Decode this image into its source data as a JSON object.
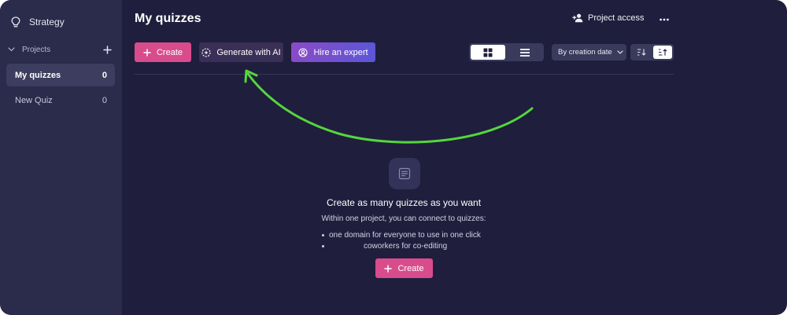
{
  "sidebar": {
    "strategy_label": "Strategy",
    "projects_label": "Projects",
    "items": [
      {
        "label": "My quizzes",
        "count": "0"
      },
      {
        "label": "New Quiz",
        "count": "0"
      }
    ]
  },
  "header": {
    "title": "My quizzes",
    "project_access_label": "Project access"
  },
  "toolbar": {
    "create_label": "Create",
    "generate_ai_label": "Generate with AI",
    "hire_expert_label": "Hire an expert",
    "sort_by_label": "By creation date"
  },
  "empty_state": {
    "title": "Create as many quizzes as you want",
    "subtitle": "Within one project, you can connect to quizzes:",
    "bullets": [
      "one domain for everyone to use in one click",
      "coworkers for co-editing"
    ],
    "create_label": "Create"
  },
  "colors": {
    "background": "#1f1e3d",
    "sidebar": "#2b2b4c",
    "accent_pink": "#d84c8c",
    "ai_button": "#3a2f56",
    "hire_gradient_start": "#8a4bc6",
    "hire_gradient_end": "#5c56d8",
    "annotation_arrow": "#54d63d"
  },
  "icons": {
    "strategy": "lightbulb-icon",
    "projects_toggle": "chevron-down-icon",
    "add_project": "plus-icon",
    "project_access": "add-user-icon",
    "more": "more-horizontal-icon",
    "create": "plus-icon",
    "generate_ai": "ai-sparkle-icon",
    "hire_expert": "user-circle-icon",
    "grid_view": "grid-view-icon",
    "list_view": "list-view-icon",
    "sort_dropdown": "chevron-down-icon",
    "sort_descending": "sort-descending-icon",
    "sort_ascending": "sort-ascending-icon",
    "empty_state": "document-icon"
  }
}
